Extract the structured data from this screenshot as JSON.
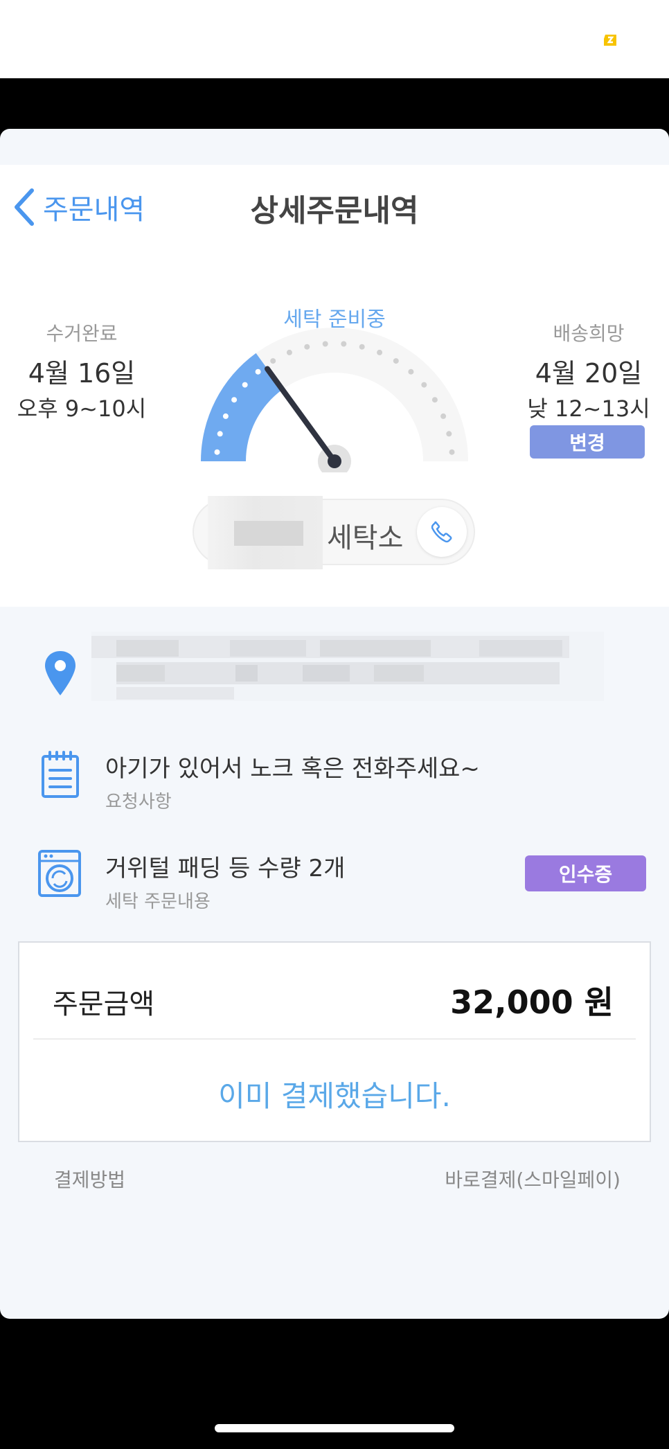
{
  "header": {
    "back_label": "주문내역",
    "title": "상세주문내역"
  },
  "tracker": {
    "pickup": {
      "label": "수거완료",
      "date": "4월 16일",
      "time": "오후 9~10시"
    },
    "status": "세탁 준비중",
    "delivery": {
      "label": "배송희망",
      "date": "4월 20일",
      "time": "낮 12~13시"
    },
    "change_label": "변경",
    "progress": 0.3,
    "shop_name": "세탁소"
  },
  "details": {
    "request": {
      "title": "아기가 있어서 노크 혹은 전화주세요~",
      "sub": "요청사항"
    },
    "order": {
      "title": "거위털 패딩 등 수량 2개",
      "sub": "세탁 주문내용",
      "receipt_label": "인수증"
    }
  },
  "payment": {
    "amount_label": "주문금액",
    "amount_value": "32,000 원",
    "paid_message": "이미 결제했습니다.",
    "method_label": "결제방법",
    "method_value": "바로결제(스마일페이)"
  },
  "colors": {
    "accent": "#4a96ee",
    "gauge_fill": "#6faaf0",
    "change_button": "#7f96e2",
    "receipt_button": "#9a7ae0"
  }
}
